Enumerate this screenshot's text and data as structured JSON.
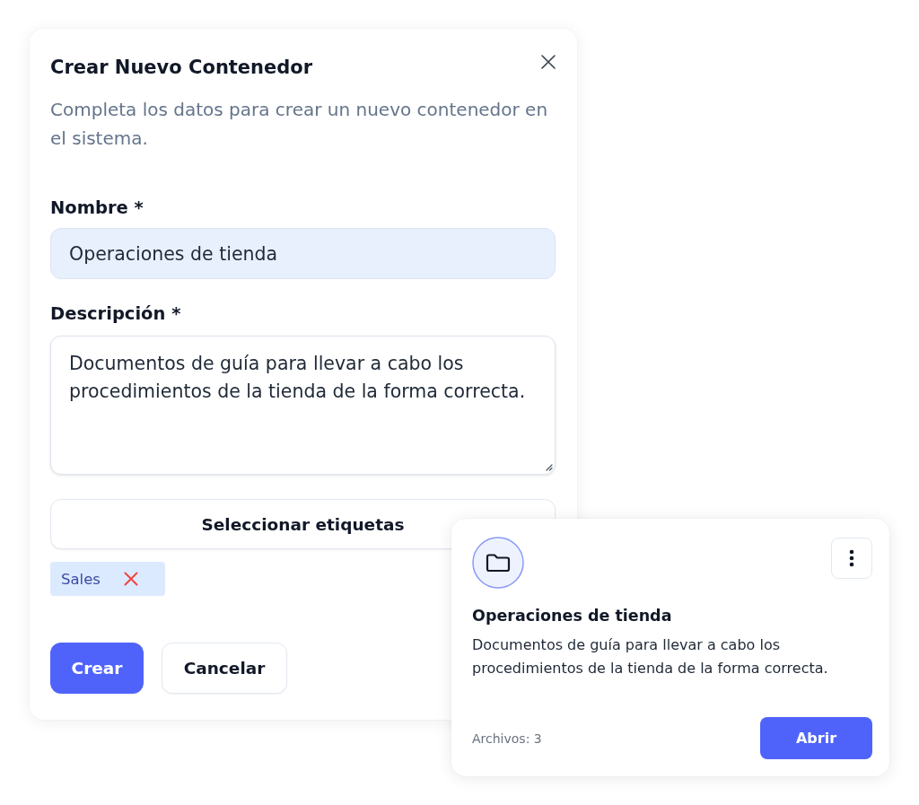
{
  "dialog": {
    "title": "Crear Nuevo Contenedor",
    "description": "Completa los datos para crear un nuevo contenedor en el sistema.",
    "fields": [
      {
        "kind": "text",
        "label": "Nombre *",
        "value": "Operaciones de tienda"
      },
      {
        "kind": "textarea",
        "label": "Descripción *",
        "value": "Documentos de guía para llevar a cabo los procedimientos de la tienda de la forma correcta."
      }
    ],
    "tag_picker": {
      "label": "Seleccionar etiquetas"
    },
    "tags": [
      {
        "label": "Sales"
      }
    ],
    "actions": [
      {
        "kind": "primary",
        "label": "Crear"
      },
      {
        "kind": "secondary",
        "label": "Cancelar"
      }
    ]
  },
  "card": {
    "title": "Operaciones de tienda",
    "description": "Documentos de guía para llevar a cabo los procedimientos de la tienda de la forma correcta.",
    "files": "Archivos: 3",
    "button": "Abrir"
  }
}
